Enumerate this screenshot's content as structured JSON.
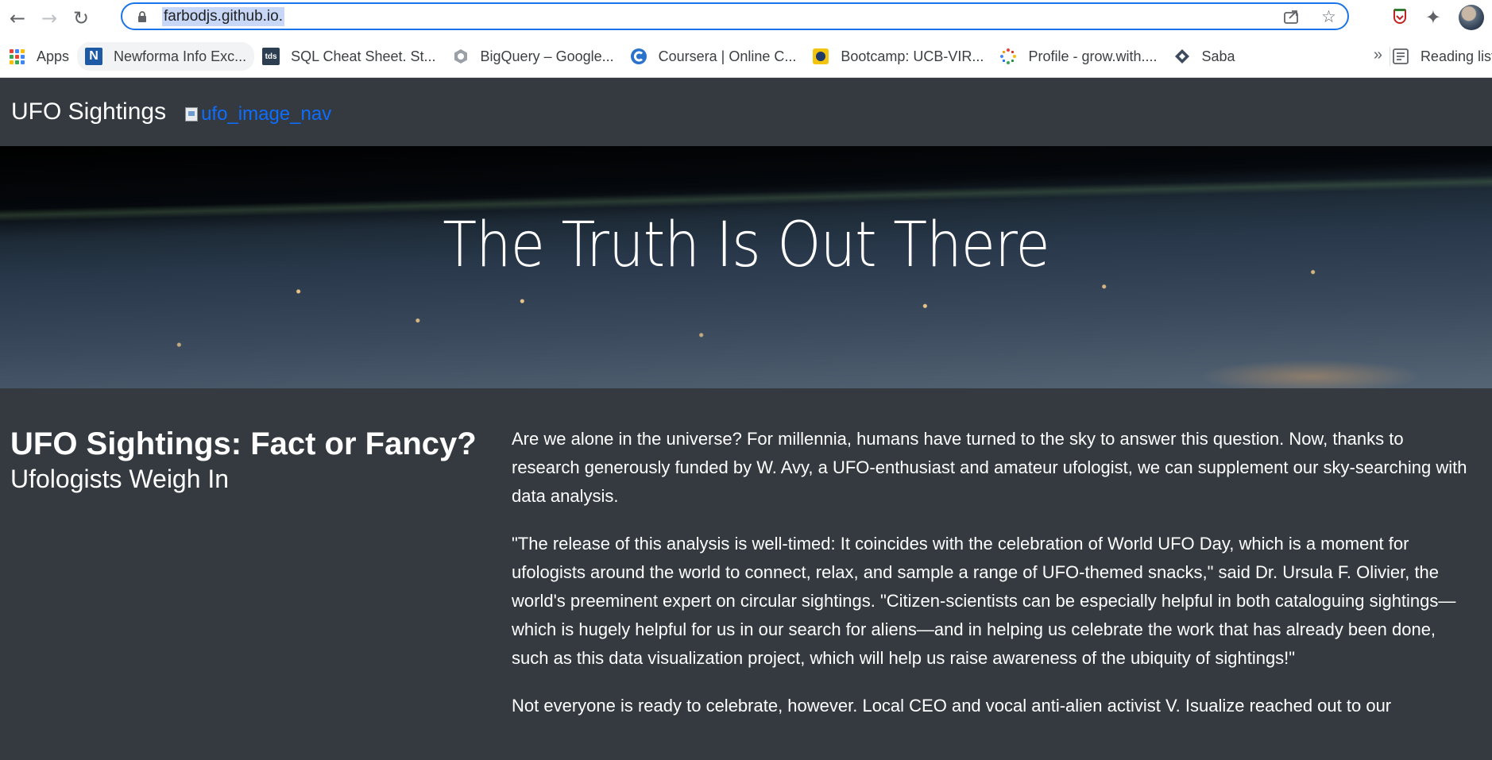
{
  "browser": {
    "url": "farbodjs.github.io.",
    "bookmarks": [
      {
        "label": "Apps",
        "icon": "apps-grid-icon"
      },
      {
        "label": "Newforma Info Exc...",
        "icon": "newforma-icon"
      },
      {
        "label": "SQL Cheat Sheet. St...",
        "icon": "tds-icon",
        "icon_text": "tds"
      },
      {
        "label": "BigQuery – Google...",
        "icon": "bigquery-icon"
      },
      {
        "label": "Coursera | Online C...",
        "icon": "coursera-icon"
      },
      {
        "label": "Bootcamp: UCB-VIR...",
        "icon": "bootcamp-icon"
      },
      {
        "label": "Profile - grow.with....",
        "icon": "grow-icon"
      },
      {
        "label": "Saba",
        "icon": "saba-icon"
      }
    ],
    "overflow_label": "»",
    "reading_list_label": "Reading list"
  },
  "site": {
    "brand": "UFO Sightings",
    "nav_image_alt": "ufo_image_nav",
    "hero_title": "The Truth Is Out There",
    "article": {
      "title": "UFO Sightings: Fact or Fancy?",
      "subtitle": "Ufologists Weigh In",
      "paragraphs": [
        "Are we alone in the universe? For millennia, humans have turned to the sky to answer this question. Now, thanks to research generously funded by W. Avy, a UFO-enthusiast and amateur ufologist, we can supplement our sky-searching with data analysis.",
        "\"The release of this analysis is well-timed: It coincides with the celebration of World UFO Day, which is a moment for ufologists around the world to connect, relax, and sample a range of UFO-themed snacks,\" said Dr. Ursula F. Olivier, the world's preeminent expert on circular sightings. \"Citizen-scientists can be especially helpful in both cataloguing sightings—which is hugely helpful for us in our search for aliens—and in helping us celebrate the work that has already been done, such as this data visualization project, which will help us raise awareness of the ubiquity of sightings!\"",
        "Not everyone is ready to celebrate, however. Local CEO and vocal anti-alien activist V. Isualize reached out to our"
      ]
    }
  },
  "colors": {
    "page_bg": "#343a40",
    "link": "#0d6efd",
    "omnibox_border": "#1a73e8",
    "url_highlight": "#c8d7f5"
  }
}
